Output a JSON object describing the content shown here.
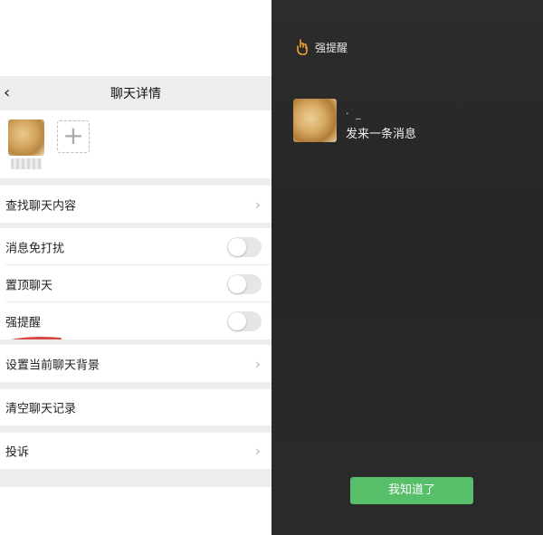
{
  "chat_detail": {
    "nav_back": "‹",
    "title": "聊天详情",
    "add_member": "+",
    "rows": {
      "search_content": "查找聊天内容",
      "mute": "消息免打扰",
      "pin": "置顶聊天",
      "strong_reminder": "强提醒",
      "set_background": "设置当前聊天背景",
      "clear_history": "清空聊天记录",
      "report": "投诉"
    },
    "chevron": "›",
    "toggles": {
      "mute": false,
      "pin": false,
      "strong_reminder": false
    }
  },
  "reminder_overlay": {
    "title": "强提醒",
    "sender": "·  _",
    "message": "发来一条消息",
    "ok_button": "我知道了"
  },
  "colors": {
    "nav_bg": "#ededed",
    "overlay_bg": "#282828",
    "accent_green": "#57be6a",
    "accent_orange": "#f0a030",
    "annotation_red": "#d9473f"
  },
  "icons": {
    "reminder": "hand-pointer-icon",
    "back": "chevron-left-icon",
    "row_arrow": "chevron-right-icon"
  }
}
